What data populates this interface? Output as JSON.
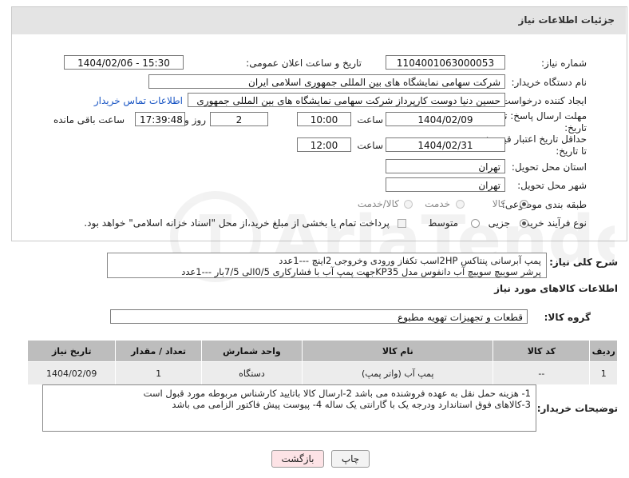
{
  "panel": {
    "title": "جزئیات اطلاعات نیاز"
  },
  "form": {
    "need_number_label": "شماره نیاز:",
    "need_number": "1104001063000053",
    "announce_label": "تاریخ و ساعت اعلان عمومی:",
    "announce_value": "1404/02/06 - 15:30",
    "buyer_org_label": "نام دستگاه خریدار:",
    "buyer_org": "شرکت سهامی نمایشگاه های بین المللی جمهوری اسلامی ایران",
    "creator_label": "ایجاد کننده درخواست:",
    "creator": "حسین دنیا دوست کارپرداز شرکت سهامی نمایشگاه های بین المللی جمهوری",
    "contact_link": "اطلاعات تماس خریدار",
    "deadline_label_1": "مهلت ارسال پاسخ: تا",
    "deadline_label_2": "تاریخ:",
    "deadline_date": "1404/02/09",
    "time_label": "ساعت",
    "deadline_time": "10:00",
    "days_value": "2",
    "days_label": "روز و",
    "remaining_time": "17:39:48",
    "remaining_label": "ساعت باقی مانده",
    "validity_label_1": "حداقل تاریخ اعتبار قیمت:",
    "validity_label_2": "تا تاریخ:",
    "validity_date": "1404/02/31",
    "validity_time_label": "ساعت",
    "validity_time": "12:00",
    "delivery_province_label": "استان محل تحویل:",
    "delivery_province": "تهران",
    "delivery_city_label": "شهر محل تحویل:",
    "delivery_city": "تهران",
    "category_label": "طبقه بندی موضوعی:",
    "category_options": [
      "کالا",
      "خدمت",
      "کالا/خدمت"
    ],
    "purchase_type_label": "نوع فرآیند خرید :",
    "purchase_options": [
      "جزیی",
      "متوسط"
    ],
    "payment_note": "پرداخت تمام یا بخشی از مبلغ خرید،از محل \"اسناد خزانه اسلامی\" خواهد بود."
  },
  "description": {
    "label": "شرح کلی نیاز:",
    "line1": "پمپ آبرسانی پنتاکس 2HPاسب تکفاز ورودی وخروجی 2اینچ ---1عدد",
    "line2": "پرشر سوییچ سوییچ آب دانفوس مدل KP35جهت پمپ آب با فشارکاری 0/5الی 7/5بار ---1عدد"
  },
  "goods": {
    "section_title": "اطلاعات کالاهای مورد نیاز",
    "group_label": "گروه کالا:",
    "group_value": "قطعات و تجهیزات تهویه مطبوع",
    "headers": [
      "ردیف",
      "کد کالا",
      "نام کالا",
      "واحد شمارش",
      "تعداد / مقدار",
      "تاریخ نیاز"
    ],
    "rows": [
      {
        "row": "1",
        "code": "--",
        "name": "پمپ آب (واتر پمپ)",
        "unit": "دستگاه",
        "qty": "1",
        "date": "1404/02/09"
      }
    ]
  },
  "buyer_notes": {
    "label": "توضیحات خریدار:",
    "line1": "1- هزینه حمل نقل به عهده فروشنده می باشد 2-ارسال کالا باتایید کارشناس مربوطه مورد قبول است",
    "line2": "3-کالاهای فوق استاندارد ودرجه یک با گارانتی یک ساله 4- پیوست پیش فاکتور الزامی می باشد"
  },
  "buttons": {
    "print": "چاپ",
    "back": "بازگشت"
  },
  "colors": {
    "header_bg": "#e4e4e4",
    "link": "#1a56c4",
    "table_head": "#bdbdbd",
    "back_btn": "#fde3e6"
  }
}
